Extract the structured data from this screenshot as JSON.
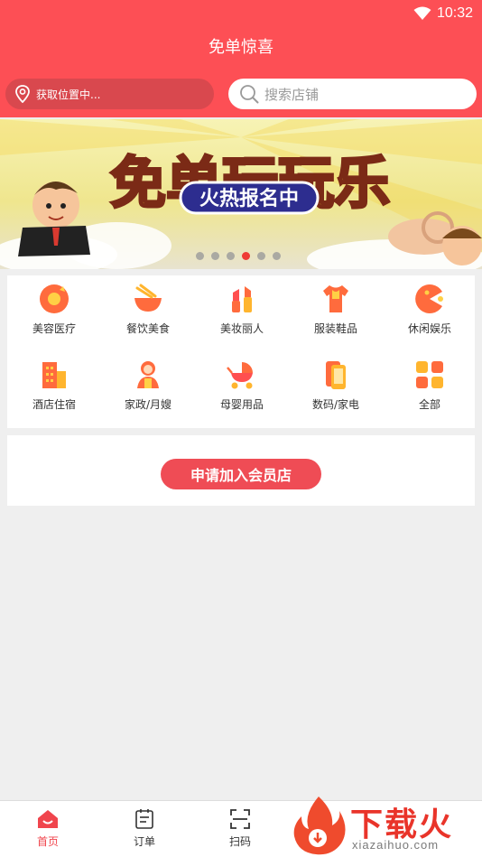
{
  "status_bar": {
    "time": "10:32",
    "icons": [
      "wifi-icon"
    ]
  },
  "header": {
    "title": "免单惊喜"
  },
  "location": {
    "text": "获取位置中...",
    "icon": "location-pin-icon"
  },
  "search": {
    "placeholder": "搜索店铺",
    "icon": "search-icon"
  },
  "banner": {
    "headline": "免单玩玩乐",
    "tag": "火热报名中",
    "dots_total": 6,
    "active_dot": 4
  },
  "categories": [
    {
      "label": "美容医疗",
      "icon": "beauty-medical-icon"
    },
    {
      "label": "餐饮美食",
      "icon": "food-bowl-icon"
    },
    {
      "label": "美妆丽人",
      "icon": "lipstick-icon"
    },
    {
      "label": "服装鞋品",
      "icon": "clothing-icon"
    },
    {
      "label": "休闲娱乐",
      "icon": "pacman-icon"
    },
    {
      "label": "酒店住宿",
      "icon": "hotel-icon"
    },
    {
      "label": "家政/月嫂",
      "icon": "housekeeper-icon"
    },
    {
      "label": "母婴用品",
      "icon": "stroller-icon"
    },
    {
      "label": "数码/家电",
      "icon": "phone-icon"
    },
    {
      "label": "全部",
      "icon": "grid-all-icon"
    }
  ],
  "join": {
    "label": "申请加入会员店"
  },
  "tabs": [
    {
      "label": "首页",
      "icon": "home-icon"
    },
    {
      "label": "订单",
      "icon": "order-icon"
    },
    {
      "label": "扫码",
      "icon": "scan-icon"
    }
  ],
  "watermark": {
    "brand": "下载火",
    "url": "xiazaihuo.com"
  },
  "colors": {
    "primary": "#fd4f55",
    "button": "#ef4c55",
    "background": "#efefef"
  }
}
